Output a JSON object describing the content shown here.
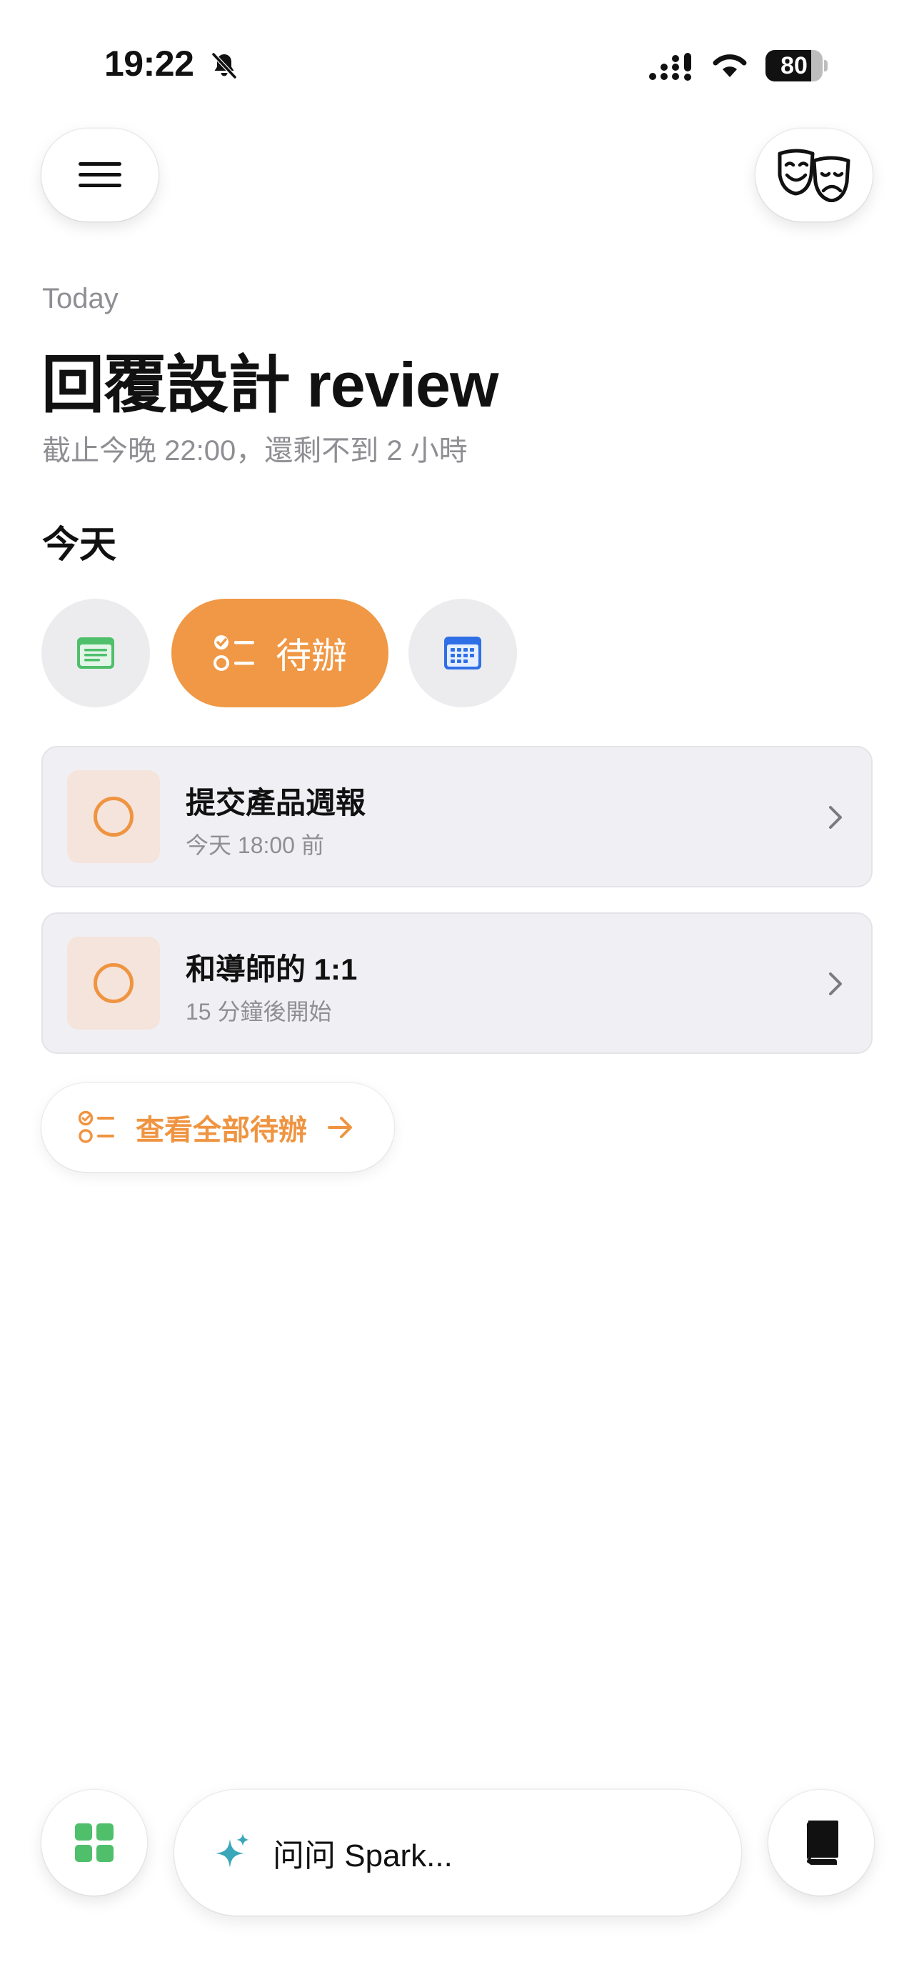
{
  "status_bar": {
    "time": "19:22",
    "battery_level": "80",
    "battery_fraction": 0.8
  },
  "header": {
    "eyebrow": "Today",
    "title": "回覆設計 review",
    "subtitle": "截止今晚 22:00，還剩不到 2 小時"
  },
  "section": {
    "heading": "今天"
  },
  "chips": {
    "items": [
      {
        "id": "notes",
        "icon": "notes-icon",
        "selected": false
      },
      {
        "id": "todo",
        "icon": "checklist-icon",
        "label": "待辦",
        "selected": true
      },
      {
        "id": "calendar",
        "icon": "calendar-icon",
        "selected": false
      }
    ]
  },
  "todos": [
    {
      "title": "提交產品週報",
      "subtitle": "今天 18:00 前"
    },
    {
      "title": "和導師的 1:1",
      "subtitle": "15 分鐘後開始"
    }
  ],
  "view_all": {
    "label": "查看全部待辦"
  },
  "bottom_bar": {
    "ask_placeholder": "问问 Spark..."
  },
  "colors": {
    "accent": "#f09845",
    "notes_green": "#4fbf6b",
    "calendar_blue": "#2f6fe6",
    "sparkle_teal": "#3aa6b9",
    "apps_green": "#4fbf6b"
  }
}
